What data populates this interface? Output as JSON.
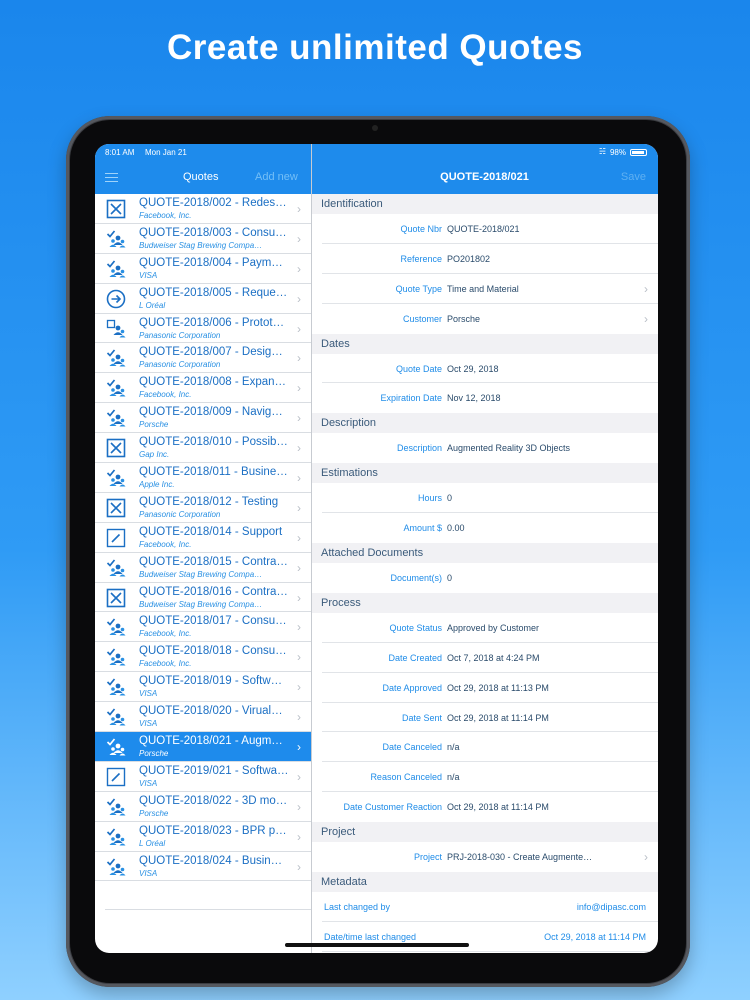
{
  "headline": "Create unlimited Quotes",
  "status_bar": {
    "time": "8:01 AM",
    "date": "Mon Jan 21",
    "battery": "98%"
  },
  "left_nav": {
    "title": "Quotes",
    "add_new": "Add new"
  },
  "right_nav": {
    "title": "QUOTE-2018/021",
    "save": "Save"
  },
  "quotes": [
    {
      "title": "QUOTE-2018/002 - Redes…",
      "client": "Facebook, Inc.",
      "icon": "rejected-icon"
    },
    {
      "title": "QUOTE-2018/003 - Consu…",
      "client": "Budweiser Stag Brewing Compa…",
      "icon": "approved-group-icon"
    },
    {
      "title": "QUOTE-2018/004 - Paym…",
      "client": "VISA",
      "icon": "approved-group-icon"
    },
    {
      "title": "QUOTE-2018/005 - Reque…",
      "client": "L Oréal",
      "icon": "sent-arrow-icon"
    },
    {
      "title": "QUOTE-2018/006 - Protot…",
      "client": "Panasonic Corporation",
      "icon": "draft-group-icon"
    },
    {
      "title": "QUOTE-2018/007 - Desig…",
      "client": "Panasonic Corporation",
      "icon": "approved-group-icon"
    },
    {
      "title": "QUOTE-2018/008 - Expan…",
      "client": "Facebook, Inc.",
      "icon": "approved-group-icon"
    },
    {
      "title": "QUOTE-2018/009 - Navig…",
      "client": "Porsche",
      "icon": "approved-group-icon"
    },
    {
      "title": "QUOTE-2018/010 - Possib…",
      "client": "Gap Inc.",
      "icon": "rejected-icon"
    },
    {
      "title": "QUOTE-2018/011 - Busine…",
      "client": "Apple Inc.",
      "icon": "approved-group-icon"
    },
    {
      "title": "QUOTE-2018/012 - Testing",
      "client": "Panasonic Corporation",
      "icon": "rejected-icon"
    },
    {
      "title": "QUOTE-2018/014 - Support",
      "client": "Facebook, Inc.",
      "icon": "edit-icon"
    },
    {
      "title": "QUOTE-2018/015 - Contra…",
      "client": "Budweiser Stag Brewing Compa…",
      "icon": "approved-group-icon"
    },
    {
      "title": "QUOTE-2018/016 - Contra…",
      "client": "Budweiser Stag Brewing Compa…",
      "icon": "rejected-icon"
    },
    {
      "title": "QUOTE-2018/017 - Consul…",
      "client": "Facebook, Inc.",
      "icon": "approved-group-icon"
    },
    {
      "title": "QUOTE-2018/018 - Consu…",
      "client": "Facebook, Inc.",
      "icon": "approved-group-icon"
    },
    {
      "title": "QUOTE-2018/019 - Softw…",
      "client": "VISA",
      "icon": "approved-group-icon"
    },
    {
      "title": "QUOTE-2018/020 - Virual…",
      "client": "VISA",
      "icon": "approved-group-icon"
    },
    {
      "title": "QUOTE-2018/021 - Augm…",
      "client": "Porsche",
      "icon": "approved-group-icon",
      "selected": true
    },
    {
      "title": "QUOTE-2019/021 - Softwa…",
      "client": "VISA",
      "icon": "edit-icon"
    },
    {
      "title": "QUOTE-2018/022 - 3D mo…",
      "client": "Porsche",
      "icon": "approved-group-icon"
    },
    {
      "title": "QUOTE-2018/023 - BPR p…",
      "client": "L Oréal",
      "icon": "approved-group-icon"
    },
    {
      "title": "QUOTE-2018/024 - Busin…",
      "client": "VISA",
      "icon": "approved-group-icon"
    }
  ],
  "detail": {
    "identification": {
      "header": "Identification",
      "quote_nbr": {
        "label": "Quote Nbr",
        "value": "QUOTE-2018/021"
      },
      "reference": {
        "label": "Reference",
        "value": "PO201802"
      },
      "quote_type": {
        "label": "Quote Type",
        "value": "Time and Material"
      },
      "customer": {
        "label": "Customer",
        "value": "Porsche"
      }
    },
    "dates": {
      "header": "Dates",
      "quote_date": {
        "label": "Quote Date",
        "value": "Oct 29, 2018"
      },
      "expiration_date": {
        "label": "Expiration Date",
        "value": "Nov 12, 2018"
      }
    },
    "description": {
      "header": "Description",
      "description": {
        "label": "Description",
        "value": "Augmented Reality 3D Objects"
      }
    },
    "estimations": {
      "header": "Estimations",
      "hours": {
        "label": "Hours",
        "value": "0"
      },
      "amount": {
        "label": "Amount $",
        "value": "0.00"
      }
    },
    "attached": {
      "header": "Attached Documents",
      "documents": {
        "label": "Document(s)",
        "value": "0"
      }
    },
    "process": {
      "header": "Process",
      "quote_status": {
        "label": "Quote Status",
        "value": "Approved by Customer"
      },
      "date_created": {
        "label": "Date Created",
        "value": "Oct 7, 2018 at 4:24 PM"
      },
      "date_approved": {
        "label": "Date Approved",
        "value": "Oct 29, 2018 at 11:13 PM"
      },
      "date_sent": {
        "label": "Date Sent",
        "value": "Oct 29, 2018 at 11:14 PM"
      },
      "date_canceled": {
        "label": "Date Canceled",
        "value": "n/a"
      },
      "reason_canceled": {
        "label": "Reason Canceled",
        "value": "n/a"
      },
      "date_customer_reaction": {
        "label": "Date Customer Reaction",
        "value": "Oct 29, 2018 at 11:14 PM"
      }
    },
    "project": {
      "header": "Project",
      "project": {
        "label": "Project",
        "value": "PRJ-2018-030 - Create Augmente…"
      }
    },
    "metadata": {
      "header": "Metadata",
      "last_changed_by": {
        "label": "Last changed by",
        "value": "info@dipasc.com"
      },
      "last_changed": {
        "label": "Date/time last changed",
        "value": "Oct 29, 2018 at 11:14 PM"
      }
    }
  },
  "colors": {
    "accent": "#1e8bec",
    "link": "#1f8ce8",
    "section_bg": "#f1f1f4"
  }
}
